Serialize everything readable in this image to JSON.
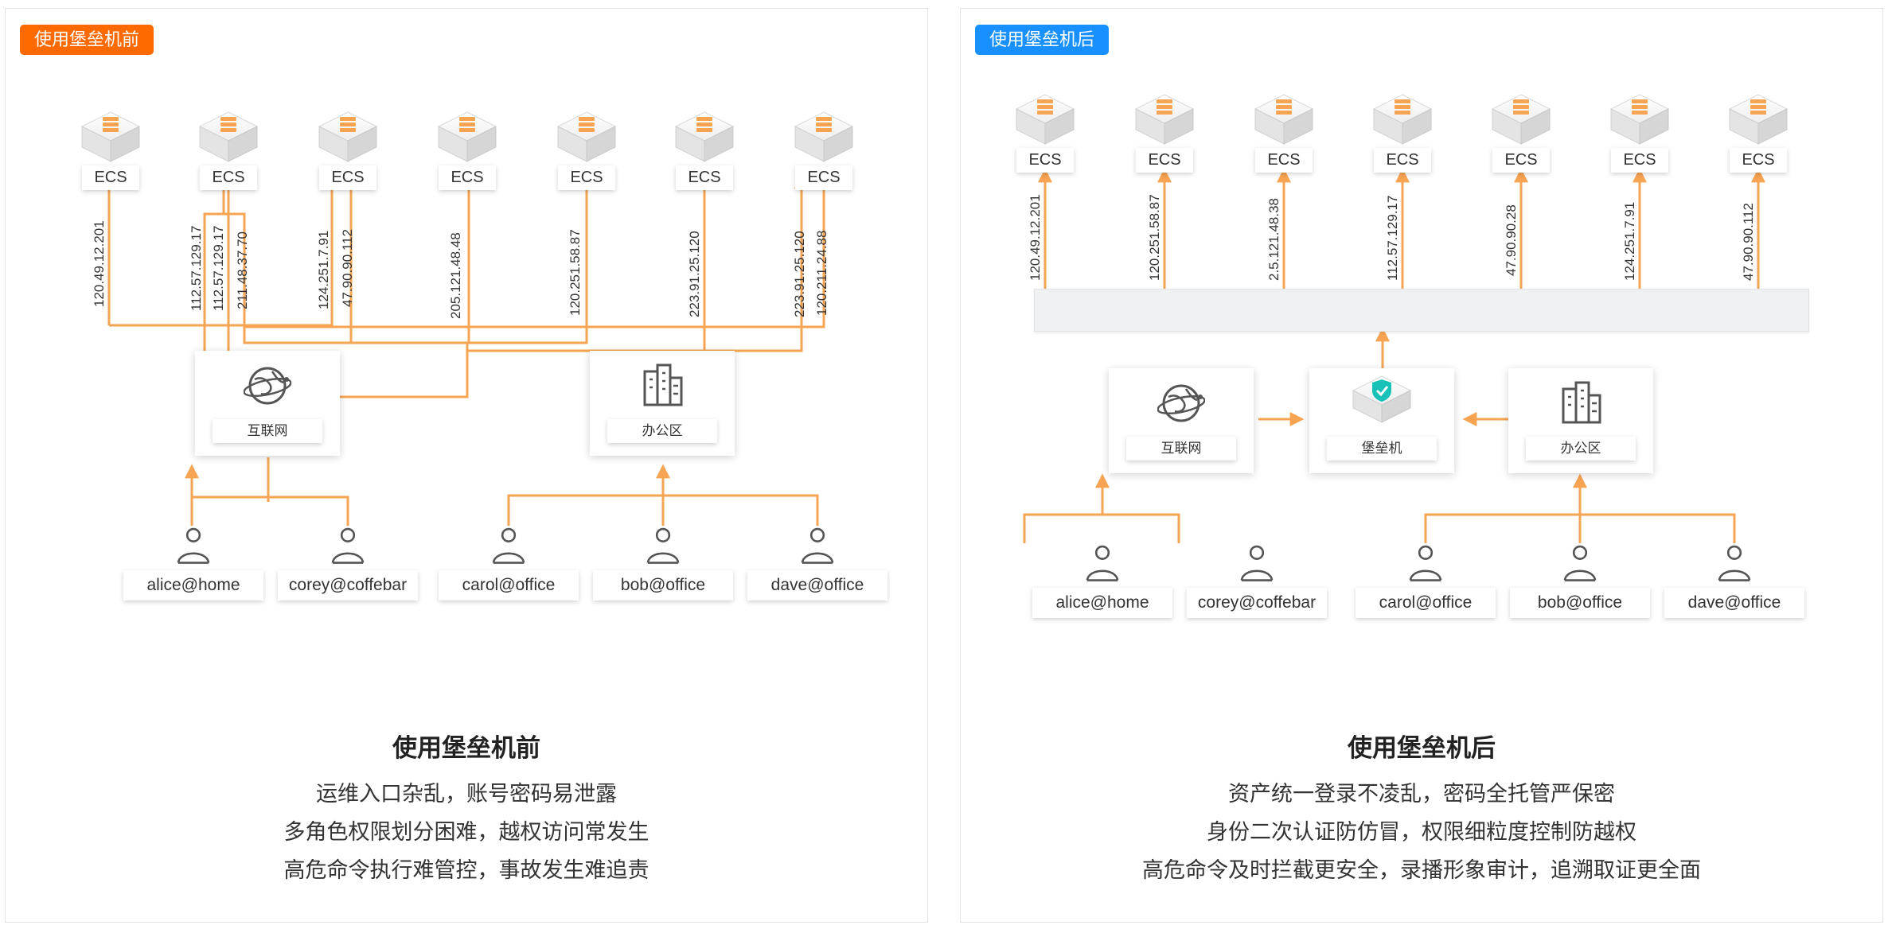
{
  "before": {
    "tag": "使用堡垒机前",
    "title": "使用堡垒机前",
    "lines": [
      "运维入口杂乱，账号密码易泄露",
      "多角色权限划分困难，越权访问常发生",
      "高危命令执行难管控，事故发生难追责"
    ],
    "ecs_label": "ECS",
    "ips": [
      "120.49.12.201",
      "112.57.129.17",
      "112.57.129.17",
      "211.48.37.70",
      "124.251.7.91",
      "47.90.90.112",
      "205.121.48.48",
      "120.251.58.87",
      "223.91.25.120",
      "223.91.25.120",
      "120.211.24.88"
    ],
    "nodes": [
      {
        "label": "互联网",
        "icon": "globe-icon"
      },
      {
        "label": "办公区",
        "icon": "building-icon"
      }
    ],
    "users": [
      "alice@home",
      "corey@coffebar",
      "carol@office",
      "bob@office",
      "dave@office"
    ]
  },
  "after": {
    "tag": "使用堡垒机后",
    "title": "使用堡垒机后",
    "lines": [
      "资产统一登录不凌乱，密码全托管严保密",
      "身份二次认证防仿冒，权限细粒度控制防越权",
      "高危命令及时拦截更安全，录播形象审计，追溯取证更全面"
    ],
    "ecs_label": "ECS",
    "ips": [
      "120.49.12.201",
      "120.251.58.87",
      "2.5.121.48.38",
      "112.57.129.17",
      "47.90.90.28",
      "124.251.7.91",
      "47.90.90.112"
    ],
    "nodes": [
      {
        "label": "互联网",
        "icon": "globe-icon"
      },
      {
        "label": "堡垒机",
        "icon": "bastion-shield-icon"
      },
      {
        "label": "办公区",
        "icon": "building-icon"
      }
    ],
    "users": [
      "alice@home",
      "corey@coffebar",
      "carol@office",
      "bob@office",
      "dave@office"
    ]
  },
  "colors": {
    "line": "#f7a452",
    "tag_before": "#ff6a00",
    "tag_after": "#1890ff",
    "server": "#f7a452"
  }
}
